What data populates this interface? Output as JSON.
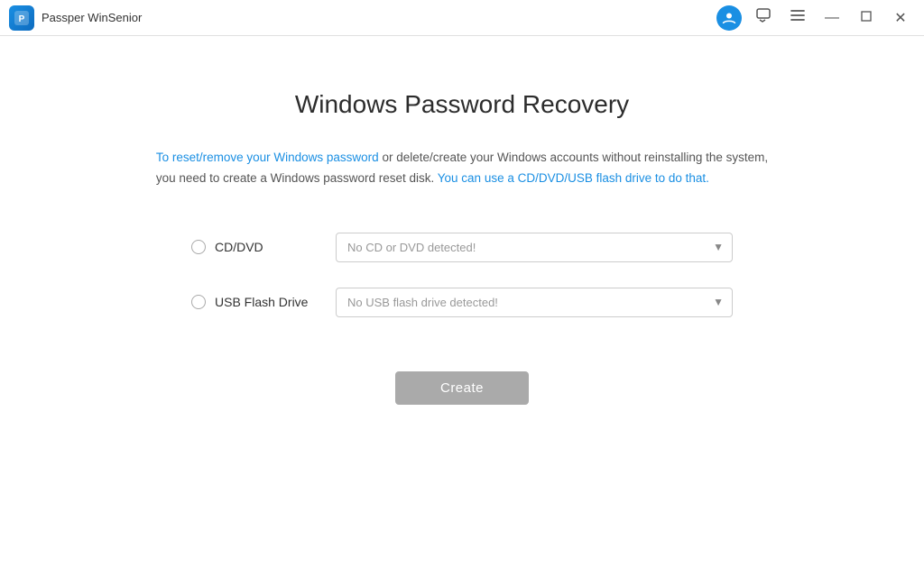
{
  "titleBar": {
    "appName": "Passper WinSenior",
    "logoText": "P",
    "buttons": {
      "minimize": "—",
      "maximize": "□",
      "close": "✕"
    }
  },
  "main": {
    "heading": "Windows Password Recovery",
    "description": {
      "part1": "To reset/remove your Windows password or delete/create your Windows accounts without reinstalling the system,",
      "part2": "you need to create a Windows password reset disk. ",
      "part3": "You can use a CD/DVD/USB flash drive to do that."
    },
    "options": [
      {
        "id": "cddvd",
        "label": "CD/DVD",
        "dropdownPlaceholder": "No CD or DVD detected!",
        "dropdownOptions": [
          "No CD or DVD detected!"
        ]
      },
      {
        "id": "usb",
        "label": "USB Flash Drive",
        "dropdownPlaceholder": "No USB flash drive detected!",
        "dropdownOptions": [
          "No USB flash drive detected!"
        ]
      }
    ],
    "createButton": "Create"
  }
}
